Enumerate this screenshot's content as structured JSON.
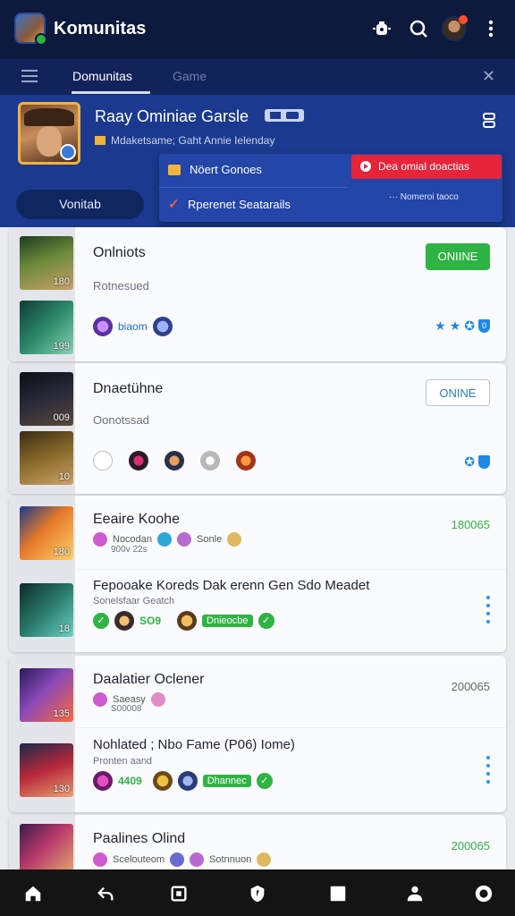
{
  "app": {
    "title": "Komunitas"
  },
  "tabs": {
    "active": "Domunitas",
    "inactive": "Game"
  },
  "profile": {
    "name": "Raay Ominiae Garsle",
    "subtitle": "Mdaketsame; Gaht Annie Ielenday",
    "button_label": "Vonitab"
  },
  "menu": {
    "item1": "Nöert Gonoes",
    "item2": "Rperenet Seatarails",
    "red_button": "Dea omial doactias",
    "sub_text": "··· Nomeroi taoco"
  },
  "colors": {
    "accent_blue": "#1b3a8f",
    "online_green": "#2fb344",
    "alert_red": "#e6243a",
    "link_blue": "#1e88e5"
  },
  "feed": {
    "card1": {
      "title": "Onlniots",
      "sub": "Rotnesued",
      "meta_name": "biaom",
      "status": "ONIINE",
      "badge_count": "0",
      "thumb1_level": "180",
      "thumb2_level": "199"
    },
    "card2": {
      "title": "Dnaetühne",
      "sub": "Oonotssad",
      "status": "ONINE",
      "thumb1_level": "009",
      "thumb2_level": "10"
    },
    "card3": {
      "title": "Eeaire Koohe",
      "count": "180065",
      "meta_line1": "Nocodan",
      "meta_line1b": "Sonle",
      "meta_line2": "900v 22s",
      "row2_title": "Fepooake Koreds Dak erenn Gen Sdo Meadet",
      "row2_sub": "Sonelsfaar Geatch",
      "row2_tag": "SO9",
      "row2_chip": "Dnieocbe",
      "thumb1_level": "180",
      "thumb2_level": "18"
    },
    "card4": {
      "title": "Daalatier Oclener",
      "count": "200065",
      "meta_line1": "Saeasy",
      "meta_line2": "S00008",
      "row2_title": "Nohlated ; Nbo Fame (P06) Iome)",
      "row2_sub": "Pronten aand",
      "row2_tag": "4409",
      "row2_chip": "Dhannec",
      "thumb1_level": "135",
      "thumb2_level": "130"
    },
    "card5": {
      "title": "Paalines Olind",
      "count": "200065",
      "meta_line1": "Scelouteom",
      "meta_line1b": "Sotnnuon"
    }
  },
  "icons": {
    "top": [
      "bug-icon",
      "search-icon",
      "user-avatar",
      "more-vertical-icon"
    ],
    "bottom_nav": [
      "home-icon",
      "back-icon",
      "square-icon",
      "shield-icon",
      "stop-icon",
      "people-icon",
      "record-icon"
    ]
  }
}
